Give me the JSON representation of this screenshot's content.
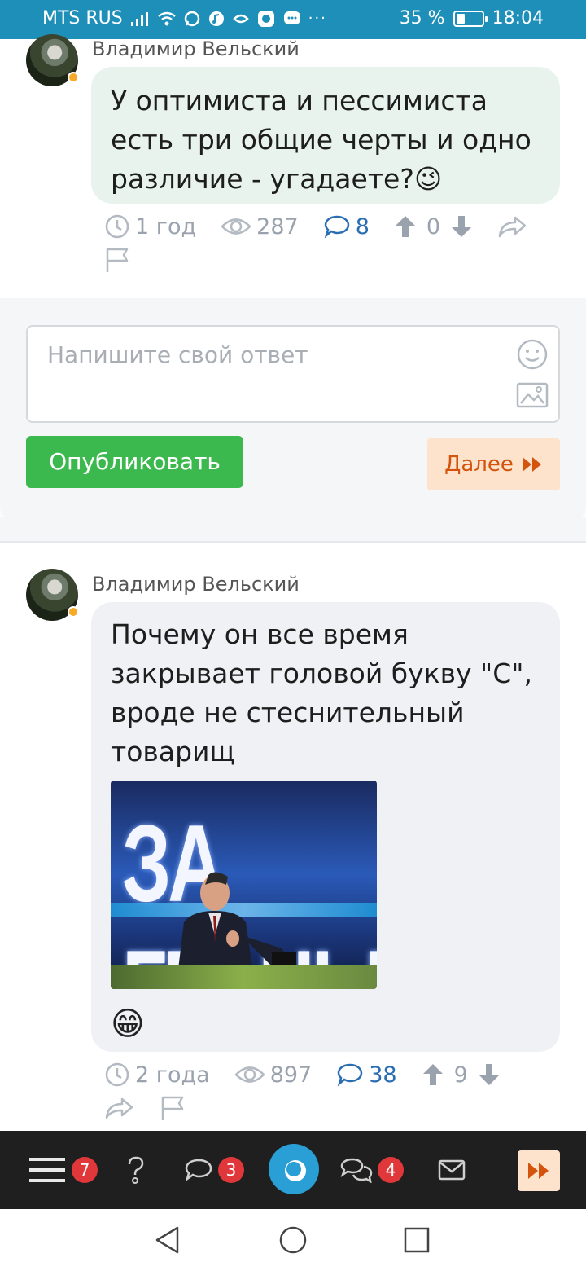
{
  "status_bar": {
    "carrier": "MTS RUS",
    "battery_percent": "35 %",
    "battery_level": 0.35,
    "time": "18:04",
    "notif_icons": [
      "signal-icon",
      "wifi-icon",
      "whatsapp-icon",
      "music-icon",
      "vpn-icon",
      "vk-icon",
      "chat-icon",
      "more-icon"
    ],
    "more": "···"
  },
  "posts": [
    {
      "author": "Владимир Вельский",
      "text": "У оптимиста и пессимиста есть три общие черты и одно различие - угадаете?",
      "emoji": "😉",
      "time": "1 год",
      "views": "287",
      "comments": "8",
      "upvotes": "0"
    },
    {
      "author": "Владимир Вельский",
      "text": "Почему он все время закрывает головой букву \"С\", вроде не стеснительный товарищ",
      "image_caption": "ЗА ГРАНЬЮ",
      "emoji": "😁",
      "time": "2 года",
      "views": "897",
      "comments": "38",
      "upvotes": "9"
    }
  ],
  "reply": {
    "placeholder": "Напишите свой ответ",
    "publish_label": "Опубликовать",
    "next_label": "Далее"
  },
  "bottom_nav": {
    "menu_badge": "7",
    "messages_badge": "3",
    "chats_badge": "4"
  },
  "colors": {
    "status_bar": "#1e8fb8",
    "publish": "#3cb94e",
    "next_bg": "#fde3cc",
    "next_fg": "#d4530d",
    "badge": "#e0383a",
    "link_blue": "#2a6db2"
  }
}
